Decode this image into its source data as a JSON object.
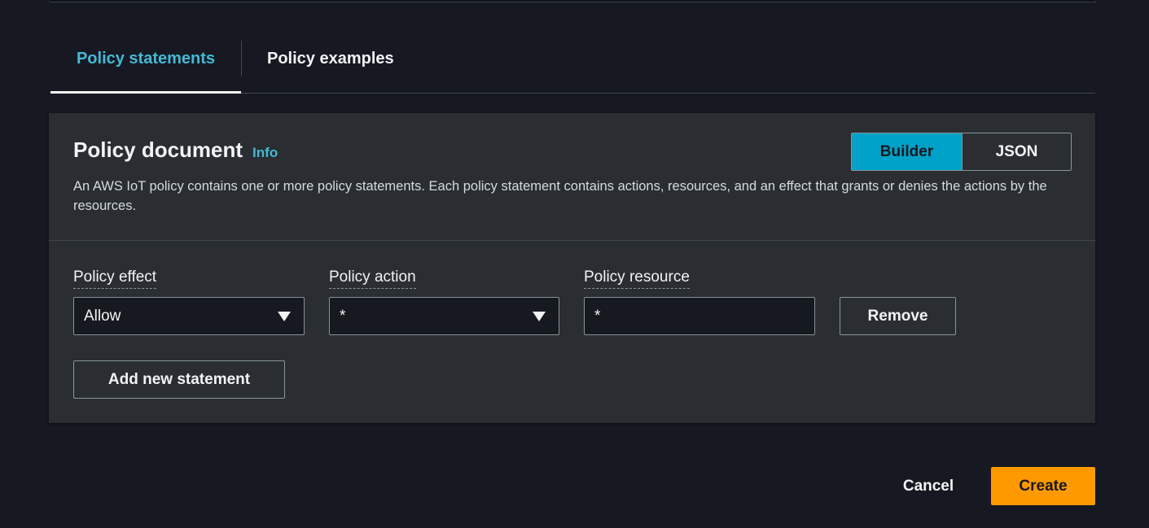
{
  "tabs": [
    {
      "label": "Policy statements",
      "active": true
    },
    {
      "label": "Policy examples",
      "active": false
    }
  ],
  "policy_document": {
    "title": "Policy document",
    "info_label": "Info",
    "description": "An AWS IoT policy contains one or more policy statements. Each policy statement contains actions, resources, and an effect that grants or denies the actions by the resources.",
    "mode_toggle": {
      "builder_label": "Builder",
      "json_label": "JSON",
      "selected": "Builder"
    },
    "statement": {
      "effect_label": "Policy effect",
      "effect_value": "Allow",
      "action_label": "Policy action",
      "action_value": "*",
      "resource_label": "Policy resource",
      "resource_value": "*",
      "remove_label": "Remove"
    },
    "add_statement_label": "Add new statement"
  },
  "footer": {
    "cancel_label": "Cancel",
    "create_label": "Create"
  },
  "colors": {
    "accent": "#44b9d6",
    "builder_selected": "#00a1c9",
    "primary_button": "#ff9900",
    "background": "#161922",
    "panel": "#2a2e33"
  }
}
